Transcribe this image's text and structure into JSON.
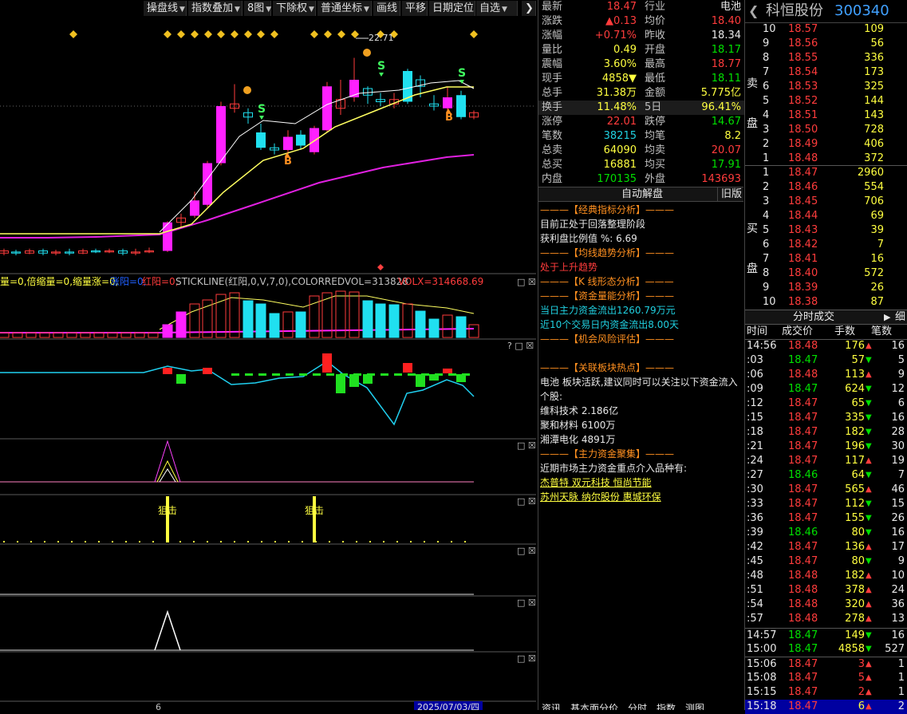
{
  "toolbar": {
    "buttons": [
      {
        "label": "操盘线",
        "caret": true
      },
      {
        "label": "指数叠加",
        "caret": true
      },
      {
        "label": "8图",
        "caret": true
      },
      {
        "label": "下除权",
        "caret": true
      },
      {
        "label": "普通坐标",
        "caret": true
      },
      {
        "label": "画线",
        "caret": false
      },
      {
        "label": "平移",
        "caret": false
      },
      {
        "label": "日期定位",
        "caret": false
      },
      {
        "label": "自选",
        "caret": true
      },
      {
        "label": "❯",
        "caret": false
      }
    ]
  },
  "chart": {
    "high_label": "22.71",
    "buy_marker": "B",
    "sell_marker": "S",
    "ind1_text": "量=0,倍缩量=0,缩量涨=0,",
    "ind1_text_b": "涨阳=0,",
    "ind1_text_c": "红阳=0,",
    "ind1_text_d": "STICKLINE(红阳,0,V,7,0),COLORREDVOL=313828",
    "ind1_text_e": "VOLX=314668.69",
    "signal_label": "狙击",
    "x_axis_tick": "6",
    "date_label": "2025/07/03/四",
    "win_controls": "□ ☒",
    "win_controls_q": "? □ ☒"
  },
  "quote": {
    "rows": [
      {
        "l1": "最新",
        "v1": "18.47",
        "v1c": "red",
        "l2": "行业",
        "v2": "电池",
        "v2c": "white"
      },
      {
        "l1": "涨跌",
        "v1": "▲0.13",
        "v1c": "red",
        "l2": "均价",
        "v2": "18.40",
        "v2c": "red"
      },
      {
        "l1": "涨幅",
        "v1": "+0.71%",
        "v1c": "red",
        "l2": "昨收",
        "v2": "18.34",
        "v2c": "white"
      },
      {
        "l1": "量比",
        "v1": "0.49",
        "v1c": "yellow",
        "l2": "开盘",
        "v2": "18.17",
        "v2c": "green"
      },
      {
        "l1": "震幅",
        "v1": "3.60%",
        "v1c": "yellow",
        "l2": "最高",
        "v2": "18.77",
        "v2c": "red"
      },
      {
        "l1": "现手",
        "v1": "4858▼",
        "v1c": "yellow",
        "l2": "最低",
        "v2": "18.11",
        "v2c": "green"
      },
      {
        "l1": "总手",
        "v1": "31.38万",
        "v1c": "yellow",
        "l2": "金额",
        "v2": "5.775亿",
        "v2c": "yellow"
      },
      {
        "l1": "换手",
        "v1": "11.48%",
        "v1c": "yellow",
        "l2": "5日",
        "v2": "96.41%",
        "v2c": "yellow"
      },
      {
        "l1": "涨停",
        "v1": "22.01",
        "v1c": "red",
        "l2": "跌停",
        "v2": "14.67",
        "v2c": "green"
      },
      {
        "l1": "笔数",
        "v1": "38215",
        "v1c": "cyan",
        "l2": "均笔",
        "v2": "8.2",
        "v2c": "yellow"
      },
      {
        "l1": "总卖",
        "v1": "64090",
        "v1c": "yellow",
        "l2": "均卖",
        "v2": "20.07",
        "v2c": "red"
      },
      {
        "l1": "总买",
        "v1": "16881",
        "v1c": "yellow",
        "l2": "均买",
        "v2": "17.91",
        "v2c": "green"
      },
      {
        "l1": "内盘",
        "v1": "170135",
        "v1c": "green",
        "l2": "外盘",
        "v2": "143693",
        "v2c": "red"
      }
    ],
    "analysis_title": "自动解盘",
    "analysis_tab": "旧版",
    "analysis": [
      {
        "t": "———【经典指标分析】———",
        "c": "orange"
      },
      {
        "t": "目前正处于回落整理阶段",
        "c": "white"
      },
      {
        "t": "获利盘比例值 %: 6.69",
        "c": "white"
      },
      {
        "t": "———【均线趋势分析】———",
        "c": "orange"
      },
      {
        "t": "处于上升趋势",
        "c": "red"
      },
      {
        "t": "———【K 线形态分析】———",
        "c": "orange"
      },
      {
        "t": "———【资金量能分析】———",
        "c": "orange"
      },
      {
        "t": "当日主力资金流出1260.79万元",
        "c": "cyan"
      },
      {
        "t": "近10个交易日内资金流出8.00天",
        "c": "cyan"
      },
      {
        "t": "———【机会风险评估】———",
        "c": "orange"
      },
      {
        "t": "",
        "c": "white"
      },
      {
        "t": "———【关联板块热点】———",
        "c": "orange"
      },
      {
        "t": "电池 板块活跃,建议同时可以关注以下资金流入",
        "c": "white"
      },
      {
        "t": "个股:",
        "c": "white"
      },
      {
        "t": "维科技术 2.186亿",
        "c": "white"
      },
      {
        "t": "聚和材料 6100万",
        "c": "white"
      },
      {
        "t": "湘潭电化 4891万",
        "c": "white"
      },
      {
        "t": "———【主力资金聚集】———",
        "c": "orange"
      },
      {
        "t": "近期市场主力资金重点介入品种有:",
        "c": "white"
      },
      {
        "t": "杰普特 双元科技 恒尚节能",
        "c": "yellow"
      },
      {
        "t": "苏州天脉 纳尔股份 惠城环保",
        "c": "yellow"
      }
    ],
    "bottom_tabs": [
      "资讯",
      "基本面",
      "分价",
      "分时",
      "指数",
      "测图"
    ]
  },
  "book": {
    "stock_name": "科恒股份",
    "stock_code": "300340",
    "back": "❮",
    "sell_label": "卖盘",
    "buy_label": "买盘",
    "sells": [
      {
        "n": "10",
        "p": "18.57",
        "v": "109"
      },
      {
        "n": "9",
        "p": "18.56",
        "v": "56"
      },
      {
        "n": "8",
        "p": "18.55",
        "v": "336"
      },
      {
        "n": "7",
        "p": "18.54",
        "v": "173"
      },
      {
        "n": "6",
        "p": "18.53",
        "v": "325"
      },
      {
        "n": "5",
        "p": "18.52",
        "v": "144"
      },
      {
        "n": "4",
        "p": "18.51",
        "v": "143"
      },
      {
        "n": "3",
        "p": "18.50",
        "v": "728"
      },
      {
        "n": "2",
        "p": "18.49",
        "v": "406"
      },
      {
        "n": "1",
        "p": "18.48",
        "v": "372"
      }
    ],
    "buys": [
      {
        "n": "1",
        "p": "18.47",
        "v": "2960"
      },
      {
        "n": "2",
        "p": "18.46",
        "v": "554"
      },
      {
        "n": "3",
        "p": "18.45",
        "v": "706"
      },
      {
        "n": "4",
        "p": "18.44",
        "v": "69"
      },
      {
        "n": "5",
        "p": "18.43",
        "v": "39"
      },
      {
        "n": "6",
        "p": "18.42",
        "v": "7"
      },
      {
        "n": "7",
        "p": "18.41",
        "v": "16"
      },
      {
        "n": "8",
        "p": "18.40",
        "v": "572"
      },
      {
        "n": "9",
        "p": "18.39",
        "v": "26"
      },
      {
        "n": "10",
        "p": "18.38",
        "v": "87"
      }
    ],
    "ticks_title": "分时成交",
    "ticks_tab": "细",
    "ticks_head": [
      "时间",
      "成交价",
      "手数",
      "笔数"
    ],
    "ticks": [
      {
        "t": "14:56",
        "p": "18.48",
        "pc": "red",
        "v": "176",
        "ar": "▲",
        "vc": "yellow",
        "n": "16"
      },
      {
        "t": ":03",
        "p": "18.47",
        "pc": "green",
        "v": "57",
        "ar": "▼",
        "vc": "yellow",
        "n": "5"
      },
      {
        "t": ":06",
        "p": "18.48",
        "pc": "red",
        "v": "113",
        "ar": "▲",
        "vc": "yellow",
        "n": "9"
      },
      {
        "t": ":09",
        "p": "18.47",
        "pc": "green",
        "v": "624",
        "ar": "▼",
        "vc": "yellow",
        "n": "12"
      },
      {
        "t": ":12",
        "p": "18.47",
        "pc": "red",
        "v": "65",
        "ar": "▼",
        "vc": "yellow",
        "n": "6"
      },
      {
        "t": ":15",
        "p": "18.47",
        "pc": "red",
        "v": "335",
        "ar": "▼",
        "vc": "yellow",
        "n": "16"
      },
      {
        "t": ":18",
        "p": "18.47",
        "pc": "red",
        "v": "182",
        "ar": "▼",
        "vc": "yellow",
        "n": "28"
      },
      {
        "t": ":21",
        "p": "18.47",
        "pc": "red",
        "v": "196",
        "ar": "▼",
        "vc": "yellow",
        "n": "30"
      },
      {
        "t": ":24",
        "p": "18.47",
        "pc": "red",
        "v": "117",
        "ar": "▲",
        "vc": "yellow",
        "n": "19"
      },
      {
        "t": ":27",
        "p": "18.46",
        "pc": "green",
        "v": "64",
        "ar": "▼",
        "vc": "yellow",
        "n": "7"
      },
      {
        "t": ":30",
        "p": "18.47",
        "pc": "red",
        "v": "565",
        "ar": "▲",
        "vc": "yellow",
        "n": "46"
      },
      {
        "t": ":33",
        "p": "18.47",
        "pc": "red",
        "v": "112",
        "ar": "▼",
        "vc": "yellow",
        "n": "15"
      },
      {
        "t": ":36",
        "p": "18.47",
        "pc": "red",
        "v": "155",
        "ar": "▼",
        "vc": "yellow",
        "n": "26"
      },
      {
        "t": ":39",
        "p": "18.46",
        "pc": "green",
        "v": "80",
        "ar": "▼",
        "vc": "yellow",
        "n": "16"
      },
      {
        "t": ":42",
        "p": "18.47",
        "pc": "red",
        "v": "136",
        "ar": "▲",
        "vc": "yellow",
        "n": "17"
      },
      {
        "t": ":45",
        "p": "18.47",
        "pc": "red",
        "v": "80",
        "ar": "▼",
        "vc": "yellow",
        "n": "9"
      },
      {
        "t": ":48",
        "p": "18.48",
        "pc": "red",
        "v": "182",
        "ar": "▲",
        "vc": "yellow",
        "n": "10"
      },
      {
        "t": ":51",
        "p": "18.48",
        "pc": "red",
        "v": "378",
        "ar": "▲",
        "vc": "yellow",
        "n": "24"
      },
      {
        "t": ":54",
        "p": "18.48",
        "pc": "red",
        "v": "320",
        "ar": "▲",
        "vc": "yellow",
        "n": "36"
      },
      {
        "t": ":57",
        "p": "18.48",
        "pc": "red",
        "v": "278",
        "ar": "▲",
        "vc": "yellow",
        "n": "13"
      },
      {
        "t": "14:57",
        "p": "18.47",
        "pc": "green",
        "v": "149",
        "ar": "▼",
        "vc": "yellow",
        "n": "16"
      },
      {
        "t": "15:00",
        "p": "18.47",
        "pc": "green",
        "v": "4858",
        "ar": "▼",
        "vc": "yellow",
        "n": "527"
      },
      {
        "t": "15:06",
        "p": "18.47",
        "pc": "red",
        "v": "3",
        "ar": "▲",
        "vc": "red",
        "n": "1"
      },
      {
        "t": "15:08",
        "p": "18.47",
        "pc": "red",
        "v": "5",
        "ar": "▲",
        "vc": "red",
        "n": "1"
      },
      {
        "t": "15:15",
        "p": "18.47",
        "pc": "red",
        "v": "2",
        "ar": "▲",
        "vc": "red",
        "n": "1"
      },
      {
        "t": "15:18",
        "p": "18.47",
        "pc": "red",
        "v": "6",
        "ar": "▲",
        "vc": "yellow",
        "n": "2"
      }
    ]
  },
  "colors": {
    "up": "#ff3c3c",
    "down": "#00e000",
    "bull_candle": "#ff20ff",
    "bear_candle": "#20e0f0",
    "ma_slow": "#e020e0",
    "ma_mid": "#ffff60",
    "ma_fast": "#ffffff"
  }
}
